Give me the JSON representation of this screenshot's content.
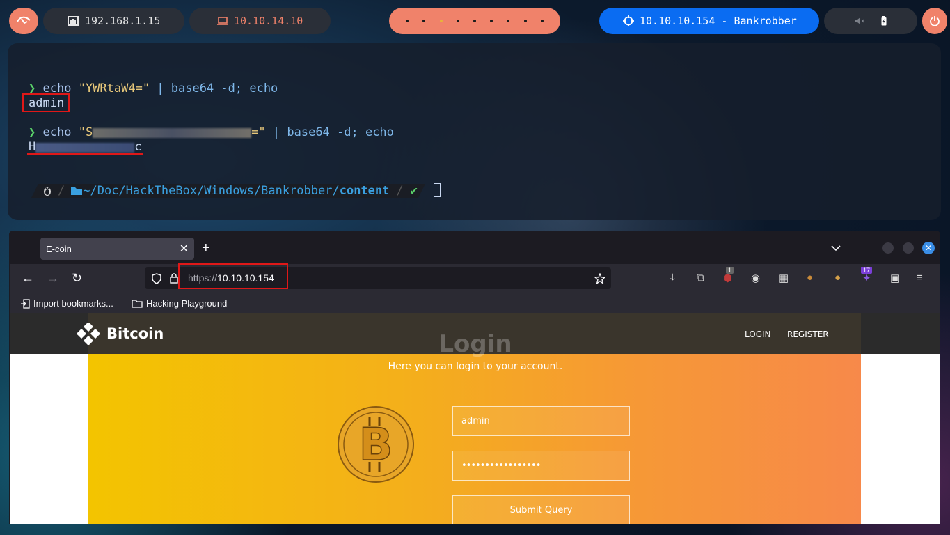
{
  "topbar": {
    "host_ip": "192.168.1.15",
    "vpn_ip": "10.10.14.10",
    "workspace_count": 9,
    "active_workspace": 3,
    "target": "10.10.10.154 - Bankrobber"
  },
  "terminal": {
    "prompt_symbol": "❯",
    "cmd1_echo": "echo",
    "cmd1_string": "\"YWRtaW4=\"",
    "cmd1_pipe": " | base64 -d; echo",
    "cmd1_output": "admin",
    "cmd2_echo": "echo",
    "cmd2_string_start": "\"S",
    "cmd2_string_end": "=\"",
    "cmd2_pipe": " | base64 -d; echo",
    "cmd2_output_start": "H",
    "cmd2_output_end": "c",
    "powerline": {
      "home": "~",
      "path": "/Doc/HackTheBox/Windows/Bankrobber/",
      "current_dir": "content",
      "status": "✔"
    }
  },
  "browser": {
    "tab_title": "E-coin",
    "url_scheme": "https://",
    "url_host": "10.10.10.154",
    "ext_badge_1": "1",
    "ext_badge_2": "17",
    "bookmarks": [
      "Import bookmarks...",
      "Hacking Playground"
    ]
  },
  "site": {
    "brand": "Bitcoin",
    "nav": [
      "LOGIN",
      "REGISTER"
    ],
    "title": "Login",
    "subtitle": "Here you can login to your account.",
    "username_value": "admin",
    "password_mask": "•••••••••••••••••",
    "submit_label": "Submit Query"
  },
  "colors": {
    "accent_salmon": "#f0826a",
    "target_blue": "#0a6cf2",
    "highlight_red": "#e01818",
    "hero_start": "#f3c400",
    "hero_end": "#f7894a"
  }
}
